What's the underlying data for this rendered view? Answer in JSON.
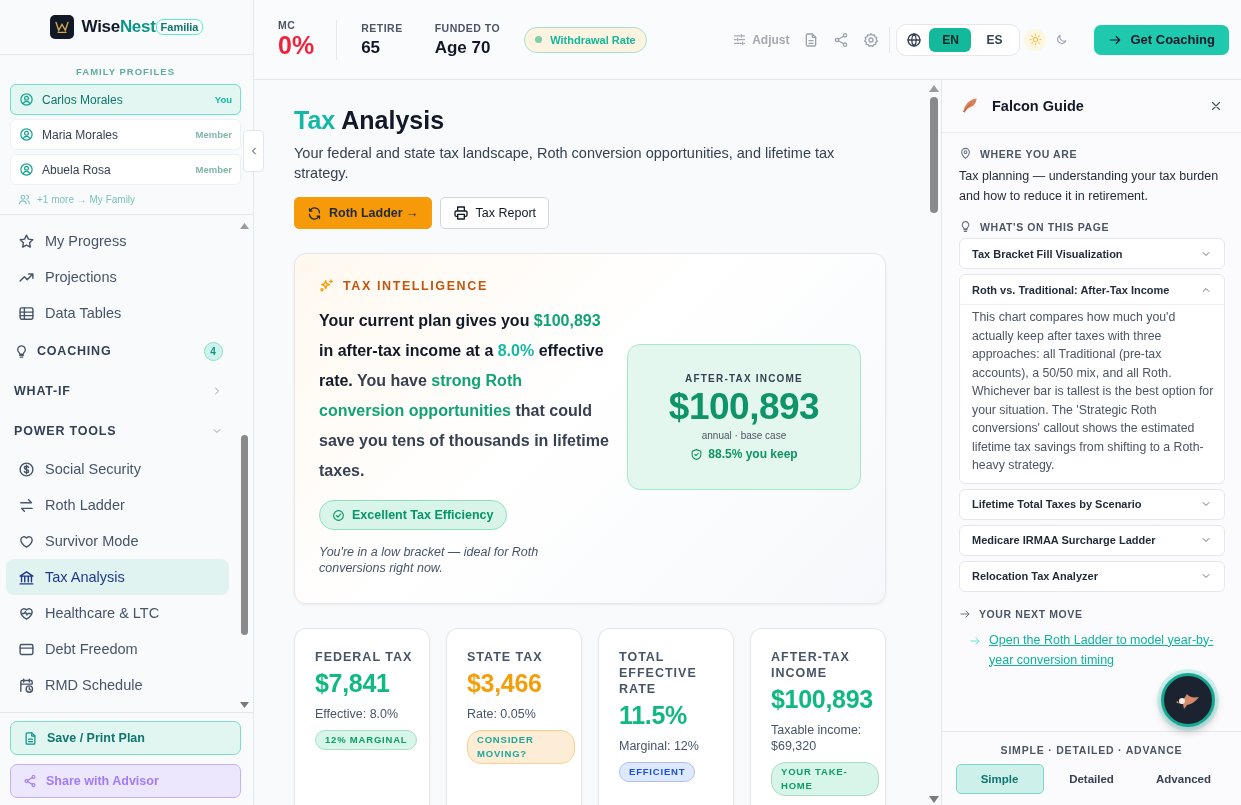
{
  "brand": {
    "name": "Wise",
    "accent": "Nest",
    "badge": "Familia"
  },
  "family": {
    "title": "FAMILY PROFILES",
    "profiles": [
      {
        "name": "Carlos Morales",
        "role": "You",
        "selected": true
      },
      {
        "name": "Maria Morales",
        "role": "Member",
        "selected": false
      },
      {
        "name": "Abuela Rosa",
        "role": "Member",
        "selected": false
      }
    ],
    "more": "+1 more → My Family"
  },
  "nav": [
    {
      "kind": "link",
      "label": "My Progress",
      "selected": false
    },
    {
      "kind": "link",
      "label": "Projections",
      "selected": false
    },
    {
      "kind": "link",
      "label": "Data Tables",
      "selected": false
    },
    {
      "kind": "section",
      "label": "COACHING",
      "count": "4"
    },
    {
      "kind": "section",
      "label": "WHAT-IF",
      "expanded": false
    },
    {
      "kind": "section",
      "label": "POWER TOOLS",
      "expanded": true
    },
    {
      "kind": "link",
      "label": "Social Security",
      "selected": false
    },
    {
      "kind": "link",
      "label": "Roth Ladder",
      "selected": false
    },
    {
      "kind": "link",
      "label": "Survivor Mode",
      "selected": false
    },
    {
      "kind": "link",
      "label": "Tax Analysis",
      "selected": true
    },
    {
      "kind": "link",
      "label": "Healthcare & LTC",
      "selected": false
    },
    {
      "kind": "link",
      "label": "Debt Freedom",
      "selected": false
    },
    {
      "kind": "link",
      "label": "RMD Schedule",
      "selected": false
    }
  ],
  "sidebar_actions": [
    {
      "label": "Save / Print Plan",
      "kind": "save"
    },
    {
      "label": "Share with Advisor",
      "kind": "share"
    }
  ],
  "topbar": {
    "stats": [
      {
        "label": "MC",
        "value": "0%",
        "color": "#ef233c"
      },
      {
        "label": "RETIRE",
        "value": "65",
        "color": "#111827"
      },
      {
        "label": "FUNDED TO",
        "value": "Age 70",
        "color": "#111827"
      }
    ],
    "pill": "Withdrawal Rate",
    "adjust": "Adjust",
    "languages": [
      {
        "label": "EN",
        "selected": true
      },
      {
        "label": "ES",
        "selected": false
      }
    ],
    "themes": [
      {
        "kind": "sun",
        "selected": true
      },
      {
        "kind": "moon",
        "selected": false
      }
    ],
    "cta": "Get Coaching"
  },
  "page": {
    "title_accent": "Tax",
    "title": "Analysis",
    "subtitle": "Your federal and state tax landscape, Roth conversion opportunities, and lifetime tax strategy.",
    "buttons": [
      {
        "label": "Roth Ladder →",
        "kind": "primary"
      },
      {
        "label": "Tax Report",
        "kind": "secondary"
      }
    ]
  },
  "intelligence": {
    "heading": "TAX INTELLIGENCE",
    "summary": [
      {
        "text": "Your current plan gives you ",
        "color": "#111827"
      },
      {
        "text": "$100,893",
        "color": "#10a374"
      },
      {
        "text": " in after-tax income at a ",
        "color": "#111827"
      },
      {
        "text": "8.0%",
        "color": "#14b8a6"
      },
      {
        "text": " effective rate.",
        "color": "#111827"
      },
      {
        "text": " You have ",
        "color": "#374151"
      },
      {
        "text": "strong Roth conversion opportunities",
        "color": "#10a374"
      },
      {
        "text": " that could save you tens of thousands in lifetime taxes.",
        "color": "#374151"
      }
    ],
    "badge": "Excellent Tax Efficiency",
    "note": "You're in a low bracket — ideal for Roth conversions right now.",
    "highlight": {
      "label": "AFTER-TAX INCOME",
      "value": "$100,893",
      "caption": "annual · base case",
      "keep": "88.5% you keep"
    }
  },
  "stats": [
    {
      "label": "FEDERAL TAX",
      "value": "$7,841",
      "color": "#10b981",
      "detail": "Effective: 8.0%",
      "badge": {
        "text": "12% MARGINAL",
        "color": "#0b9c6c"
      }
    },
    {
      "label": "STATE TAX",
      "value": "$3,466",
      "color": "#f59e0b",
      "detail": "Rate: 0.05%",
      "badge": {
        "text": "CONSIDER MOVING?",
        "color": "#1aa89a"
      }
    },
    {
      "label": "TOTAL EFFECTIVE RATE",
      "value": "11.5%",
      "color": "#10b981",
      "detail": "Marginal: 12%",
      "badge": {
        "text": "EFFICIENT",
        "color": "#1d4ed8"
      }
    },
    {
      "label": "AFTER-TAX INCOME",
      "value": "$100,893",
      "color": "#10b981",
      "detail": "Taxable income: $69,320",
      "badge": {
        "text": "YOUR TAKE-HOME",
        "color": "#0b9c6c"
      }
    }
  ],
  "guide": {
    "title": "Falcon Guide",
    "where_label": "WHERE YOU ARE",
    "where_text": "Tax planning — understanding your tax burden and how to reduce it in retirement.",
    "page_label": "WHAT'S ON THIS PAGE",
    "topics": [
      {
        "title": "Tax Bracket Fill Visualization",
        "expanded": false
      },
      {
        "title": "Roth vs. Traditional: After-Tax Income",
        "expanded": true,
        "body": "This chart compares how much you'd actually keep after taxes with three approaches: all Traditional (pre-tax accounts), a 50/50 mix, and all Roth. Whichever bar is tallest is the best option for your situation. The 'Strategic Roth conversions' callout shows the estimated lifetime tax savings from shifting to a Roth-heavy strategy."
      },
      {
        "title": "Lifetime Total Taxes by Scenario",
        "expanded": false
      },
      {
        "title": "Medicare IRMAA Surcharge Ladder",
        "expanded": false
      },
      {
        "title": "Relocation Tax Analyzer",
        "expanded": false
      }
    ],
    "next_label": "YOUR NEXT MOVE",
    "next_link": "Open the Roth Ladder to model year-by-year conversion timing",
    "mode_label": "SIMPLE · DETAILED · ADVANCE",
    "modes": [
      {
        "label": "Simple",
        "selected": true
      },
      {
        "label": "Detailed",
        "selected": false
      },
      {
        "label": "Advanced",
        "selected": false
      }
    ]
  }
}
